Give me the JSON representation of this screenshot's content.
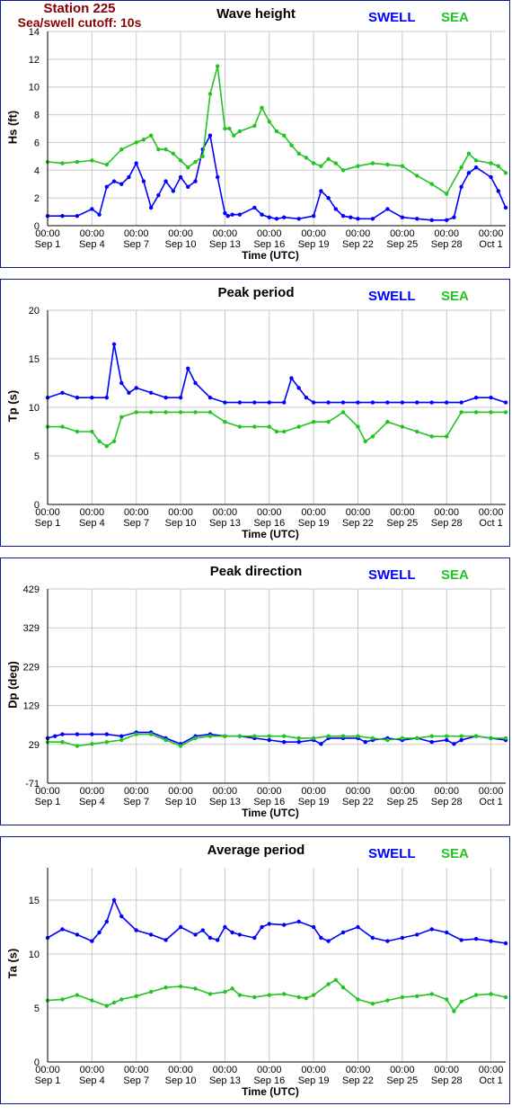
{
  "header": {
    "station": "Station 225",
    "cutoff": "Sea/swell cutoff: 10s"
  },
  "legend": {
    "swell": "SWELL",
    "sea": "SEA"
  },
  "colors": {
    "swell": "#0000ff",
    "sea": "#22c422",
    "title": "#8b0000",
    "frame": "#0b1a8a"
  },
  "x_axis": {
    "label": "Time (UTC)",
    "ticks": [
      {
        "day": 1,
        "time": "00:00",
        "date": "Sep 1"
      },
      {
        "day": 4,
        "time": "00:00",
        "date": "Sep 4"
      },
      {
        "day": 7,
        "time": "00:00",
        "date": "Sep 7"
      },
      {
        "day": 10,
        "time": "00:00",
        "date": "Sep 10"
      },
      {
        "day": 13,
        "time": "00:00",
        "date": "Sep 13"
      },
      {
        "day": 16,
        "time": "00:00",
        "date": "Sep 16"
      },
      {
        "day": 19,
        "time": "00:00",
        "date": "Sep 19"
      },
      {
        "day": 22,
        "time": "00:00",
        "date": "Sep 22"
      },
      {
        "day": 25,
        "time": "00:00",
        "date": "Sep 25"
      },
      {
        "day": 28,
        "time": "00:00",
        "date": "Sep 28"
      },
      {
        "day": 31,
        "time": "00:00",
        "date": "Oct 1"
      }
    ],
    "range_days": [
      1,
      32
    ]
  },
  "chart_data": [
    {
      "type": "line",
      "title": "Wave height",
      "ylabel": "Hs (ft)",
      "ylim": [
        0,
        14
      ],
      "yticks": [
        0,
        2,
        4,
        6,
        8,
        10,
        12,
        14
      ],
      "grid": true,
      "legend_position": "top-right",
      "series": [
        {
          "name": "SWELL",
          "x": [
            1,
            2,
            3,
            4,
            4.5,
            5,
            5.5,
            6,
            6.5,
            7,
            7.5,
            8,
            8.5,
            9,
            9.5,
            10,
            10.5,
            11,
            11.5,
            12,
            12.5,
            13,
            13.2,
            13.5,
            14,
            15,
            15.5,
            16,
            16.5,
            17,
            18,
            19,
            19.5,
            20,
            20.5,
            21,
            21.5,
            22,
            23,
            24,
            25,
            26,
            27,
            28,
            28.5,
            29,
            29.5,
            30,
            31,
            31.5,
            32
          ],
          "y": [
            0.7,
            0.7,
            0.7,
            1.2,
            0.8,
            2.8,
            3.2,
            3,
            3.5,
            4.5,
            3.2,
            1.3,
            2.2,
            3.2,
            2.5,
            3.5,
            2.8,
            3.2,
            5.5,
            6.5,
            3.5,
            0.9,
            0.7,
            0.8,
            0.8,
            1.3,
            0.8,
            0.6,
            0.5,
            0.6,
            0.5,
            0.7,
            2.5,
            2,
            1.2,
            0.7,
            0.6,
            0.5,
            0.5,
            1.2,
            0.6,
            0.5,
            0.4,
            0.4,
            0.6,
            2.8,
            3.8,
            4.2,
            3.5,
            2.5,
            1.3
          ]
        },
        {
          "name": "SEA",
          "x": [
            1,
            2,
            3,
            4,
            5,
            6,
            7,
            7.5,
            8,
            8.5,
            9,
            9.5,
            10,
            10.5,
            11,
            11.5,
            12,
            12.5,
            13,
            13.3,
            13.6,
            14,
            15,
            15.5,
            16,
            16.5,
            17,
            17.5,
            18,
            18.5,
            19,
            19.5,
            20,
            20.5,
            21,
            22,
            23,
            24,
            25,
            26,
            27,
            28,
            29,
            29.5,
            30,
            31,
            31.5,
            32
          ],
          "y": [
            4.6,
            4.5,
            4.6,
            4.7,
            4.4,
            5.5,
            6,
            6.2,
            6.5,
            5.5,
            5.5,
            5.2,
            4.7,
            4.2,
            4.6,
            5,
            9.5,
            11.5,
            7,
            7,
            6.5,
            6.8,
            7.2,
            8.5,
            7.5,
            6.8,
            6.5,
            5.8,
            5.2,
            4.9,
            4.5,
            4.3,
            4.8,
            4.5,
            4,
            4.3,
            4.5,
            4.4,
            4.3,
            3.6,
            3,
            2.3,
            4.2,
            5.2,
            4.7,
            4.5,
            4.3,
            3.8
          ]
        }
      ]
    },
    {
      "type": "line",
      "title": "Peak period",
      "ylabel": "Tp (s)",
      "ylim": [
        0,
        20
      ],
      "yticks": [
        0,
        5,
        10,
        15,
        20
      ],
      "grid": true,
      "legend_position": "top-right",
      "series": [
        {
          "name": "SWELL",
          "x": [
            1,
            2,
            3,
            4,
            5,
            5.5,
            6,
            6.5,
            7,
            8,
            9,
            10,
            10.5,
            11,
            12,
            13,
            14,
            15,
            16,
            17,
            17.5,
            18,
            18.5,
            19,
            20,
            21,
            22,
            23,
            24,
            25,
            26,
            27,
            28,
            29,
            30,
            31,
            32
          ],
          "y": [
            11,
            11.5,
            11,
            11,
            11,
            16.5,
            12.5,
            11.5,
            12,
            11.5,
            11,
            11,
            14,
            12.5,
            11,
            10.5,
            10.5,
            10.5,
            10.5,
            10.5,
            13,
            12,
            11,
            10.5,
            10.5,
            10.5,
            10.5,
            10.5,
            10.5,
            10.5,
            10.5,
            10.5,
            10.5,
            10.5,
            11,
            11,
            10.5
          ]
        },
        {
          "name": "SEA",
          "x": [
            1,
            2,
            3,
            4,
            4.5,
            5,
            5.5,
            6,
            7,
            8,
            9,
            10,
            11,
            12,
            13,
            14,
            15,
            16,
            16.5,
            17,
            18,
            19,
            20,
            21,
            22,
            22.5,
            23,
            24,
            25,
            26,
            27,
            28,
            29,
            30,
            31,
            32
          ],
          "y": [
            8,
            8,
            7.5,
            7.5,
            6.5,
            6,
            6.5,
            9,
            9.5,
            9.5,
            9.5,
            9.5,
            9.5,
            9.5,
            8.5,
            8,
            8,
            8,
            7.5,
            7.5,
            8,
            8.5,
            8.5,
            9.5,
            8,
            6.5,
            7,
            8.5,
            8,
            7.5,
            7,
            7,
            9.5,
            9.5,
            9.5,
            9.5
          ]
        }
      ]
    },
    {
      "type": "line",
      "title": "Peak direction",
      "ylabel": "Dp (deg)",
      "ylim": [
        -71,
        429
      ],
      "yticks": [
        -71,
        29,
        129,
        229,
        329,
        429
      ],
      "grid": true,
      "legend_position": "top-right",
      "series": [
        {
          "name": "SWELL",
          "x": [
            1,
            1.5,
            2,
            3,
            4,
            5,
            6,
            7,
            8,
            9,
            10,
            11,
            12,
            13,
            14,
            15,
            16,
            17,
            18,
            19,
            19.5,
            20,
            21,
            22,
            22.5,
            23,
            24,
            25,
            26,
            27,
            28,
            28.5,
            29,
            30,
            31,
            32
          ],
          "y": [
            45,
            50,
            55,
            55,
            55,
            55,
            50,
            60,
            60,
            45,
            30,
            50,
            55,
            50,
            50,
            45,
            40,
            35,
            35,
            40,
            30,
            45,
            45,
            45,
            35,
            40,
            45,
            40,
            45,
            35,
            40,
            30,
            40,
            50,
            45,
            40
          ]
        },
        {
          "name": "SEA",
          "x": [
            1,
            2,
            3,
            4,
            5,
            6,
            7,
            8,
            9,
            10,
            11,
            12,
            13,
            14,
            15,
            16,
            17,
            18,
            19,
            20,
            21,
            22,
            23,
            24,
            25,
            26,
            27,
            28,
            29,
            30,
            31,
            32
          ],
          "y": [
            35,
            35,
            25,
            30,
            35,
            40,
            55,
            55,
            40,
            25,
            45,
            50,
            50,
            50,
            50,
            50,
            50,
            45,
            45,
            50,
            50,
            50,
            45,
            40,
            45,
            45,
            50,
            50,
            50,
            50,
            45,
            45
          ]
        }
      ]
    },
    {
      "type": "line",
      "title": "Average period",
      "ylabel": "Ta (s)",
      "ylim": [
        0,
        18
      ],
      "yticks": [
        0,
        5,
        10,
        15
      ],
      "grid": true,
      "legend_position": "top-right",
      "series": [
        {
          "name": "SWELL",
          "x": [
            1,
            2,
            3,
            4,
            4.5,
            5,
            5.5,
            6,
            7,
            8,
            9,
            10,
            11,
            11.5,
            12,
            12.5,
            13,
            13.5,
            14,
            15,
            15.5,
            16,
            17,
            18,
            19,
            19.5,
            20,
            21,
            22,
            23,
            24,
            25,
            26,
            27,
            28,
            29,
            30,
            31,
            32
          ],
          "y": [
            11.5,
            12.3,
            11.8,
            11.2,
            12,
            13,
            15,
            13.5,
            12.2,
            11.8,
            11.3,
            12.5,
            11.8,
            12.2,
            11.5,
            11.3,
            12.5,
            12,
            11.8,
            11.5,
            12.5,
            12.8,
            12.7,
            13,
            12.5,
            11.5,
            11.2,
            12,
            12.5,
            11.5,
            11.2,
            11.5,
            11.8,
            12.3,
            12,
            11.3,
            11.4,
            11.2,
            11
          ]
        },
        {
          "name": "SEA",
          "x": [
            1,
            2,
            3,
            4,
            5,
            5.5,
            6,
            7,
            8,
            9,
            10,
            11,
            12,
            13,
            13.5,
            14,
            15,
            16,
            17,
            18,
            18.5,
            19,
            20,
            20.5,
            21,
            22,
            23,
            24,
            25,
            26,
            27,
            28,
            28.5,
            29,
            30,
            31,
            32
          ],
          "y": [
            5.7,
            5.8,
            6.2,
            5.7,
            5.2,
            5.5,
            5.8,
            6.1,
            6.5,
            6.9,
            7,
            6.8,
            6.3,
            6.5,
            6.8,
            6.2,
            6,
            6.2,
            6.3,
            6,
            5.9,
            6.2,
            7.2,
            7.6,
            6.9,
            5.8,
            5.4,
            5.7,
            6,
            6.1,
            6.3,
            5.8,
            4.7,
            5.6,
            6.2,
            6.3,
            6
          ]
        }
      ]
    }
  ]
}
